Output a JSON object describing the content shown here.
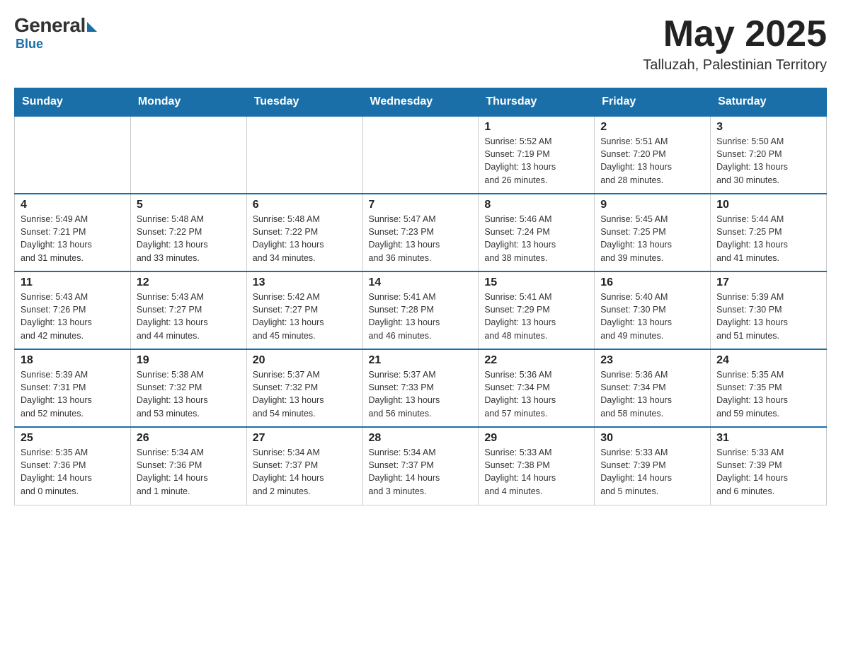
{
  "header": {
    "logo": {
      "general": "General",
      "blue": "Blue"
    },
    "title": "May 2025",
    "location": "Talluzah, Palestinian Territory"
  },
  "calendar": {
    "days_of_week": [
      "Sunday",
      "Monday",
      "Tuesday",
      "Wednesday",
      "Thursday",
      "Friday",
      "Saturday"
    ],
    "weeks": [
      {
        "days": [
          {
            "date": "",
            "info": ""
          },
          {
            "date": "",
            "info": ""
          },
          {
            "date": "",
            "info": ""
          },
          {
            "date": "",
            "info": ""
          },
          {
            "date": "1",
            "info": "Sunrise: 5:52 AM\nSunset: 7:19 PM\nDaylight: 13 hours\nand 26 minutes."
          },
          {
            "date": "2",
            "info": "Sunrise: 5:51 AM\nSunset: 7:20 PM\nDaylight: 13 hours\nand 28 minutes."
          },
          {
            "date": "3",
            "info": "Sunrise: 5:50 AM\nSunset: 7:20 PM\nDaylight: 13 hours\nand 30 minutes."
          }
        ]
      },
      {
        "days": [
          {
            "date": "4",
            "info": "Sunrise: 5:49 AM\nSunset: 7:21 PM\nDaylight: 13 hours\nand 31 minutes."
          },
          {
            "date": "5",
            "info": "Sunrise: 5:48 AM\nSunset: 7:22 PM\nDaylight: 13 hours\nand 33 minutes."
          },
          {
            "date": "6",
            "info": "Sunrise: 5:48 AM\nSunset: 7:22 PM\nDaylight: 13 hours\nand 34 minutes."
          },
          {
            "date": "7",
            "info": "Sunrise: 5:47 AM\nSunset: 7:23 PM\nDaylight: 13 hours\nand 36 minutes."
          },
          {
            "date": "8",
            "info": "Sunrise: 5:46 AM\nSunset: 7:24 PM\nDaylight: 13 hours\nand 38 minutes."
          },
          {
            "date": "9",
            "info": "Sunrise: 5:45 AM\nSunset: 7:25 PM\nDaylight: 13 hours\nand 39 minutes."
          },
          {
            "date": "10",
            "info": "Sunrise: 5:44 AM\nSunset: 7:25 PM\nDaylight: 13 hours\nand 41 minutes."
          }
        ]
      },
      {
        "days": [
          {
            "date": "11",
            "info": "Sunrise: 5:43 AM\nSunset: 7:26 PM\nDaylight: 13 hours\nand 42 minutes."
          },
          {
            "date": "12",
            "info": "Sunrise: 5:43 AM\nSunset: 7:27 PM\nDaylight: 13 hours\nand 44 minutes."
          },
          {
            "date": "13",
            "info": "Sunrise: 5:42 AM\nSunset: 7:27 PM\nDaylight: 13 hours\nand 45 minutes."
          },
          {
            "date": "14",
            "info": "Sunrise: 5:41 AM\nSunset: 7:28 PM\nDaylight: 13 hours\nand 46 minutes."
          },
          {
            "date": "15",
            "info": "Sunrise: 5:41 AM\nSunset: 7:29 PM\nDaylight: 13 hours\nand 48 minutes."
          },
          {
            "date": "16",
            "info": "Sunrise: 5:40 AM\nSunset: 7:30 PM\nDaylight: 13 hours\nand 49 minutes."
          },
          {
            "date": "17",
            "info": "Sunrise: 5:39 AM\nSunset: 7:30 PM\nDaylight: 13 hours\nand 51 minutes."
          }
        ]
      },
      {
        "days": [
          {
            "date": "18",
            "info": "Sunrise: 5:39 AM\nSunset: 7:31 PM\nDaylight: 13 hours\nand 52 minutes."
          },
          {
            "date": "19",
            "info": "Sunrise: 5:38 AM\nSunset: 7:32 PM\nDaylight: 13 hours\nand 53 minutes."
          },
          {
            "date": "20",
            "info": "Sunrise: 5:37 AM\nSunset: 7:32 PM\nDaylight: 13 hours\nand 54 minutes."
          },
          {
            "date": "21",
            "info": "Sunrise: 5:37 AM\nSunset: 7:33 PM\nDaylight: 13 hours\nand 56 minutes."
          },
          {
            "date": "22",
            "info": "Sunrise: 5:36 AM\nSunset: 7:34 PM\nDaylight: 13 hours\nand 57 minutes."
          },
          {
            "date": "23",
            "info": "Sunrise: 5:36 AM\nSunset: 7:34 PM\nDaylight: 13 hours\nand 58 minutes."
          },
          {
            "date": "24",
            "info": "Sunrise: 5:35 AM\nSunset: 7:35 PM\nDaylight: 13 hours\nand 59 minutes."
          }
        ]
      },
      {
        "days": [
          {
            "date": "25",
            "info": "Sunrise: 5:35 AM\nSunset: 7:36 PM\nDaylight: 14 hours\nand 0 minutes."
          },
          {
            "date": "26",
            "info": "Sunrise: 5:34 AM\nSunset: 7:36 PM\nDaylight: 14 hours\nand 1 minute."
          },
          {
            "date": "27",
            "info": "Sunrise: 5:34 AM\nSunset: 7:37 PM\nDaylight: 14 hours\nand 2 minutes."
          },
          {
            "date": "28",
            "info": "Sunrise: 5:34 AM\nSunset: 7:37 PM\nDaylight: 14 hours\nand 3 minutes."
          },
          {
            "date": "29",
            "info": "Sunrise: 5:33 AM\nSunset: 7:38 PM\nDaylight: 14 hours\nand 4 minutes."
          },
          {
            "date": "30",
            "info": "Sunrise: 5:33 AM\nSunset: 7:39 PM\nDaylight: 14 hours\nand 5 minutes."
          },
          {
            "date": "31",
            "info": "Sunrise: 5:33 AM\nSunset: 7:39 PM\nDaylight: 14 hours\nand 6 minutes."
          }
        ]
      }
    ]
  }
}
